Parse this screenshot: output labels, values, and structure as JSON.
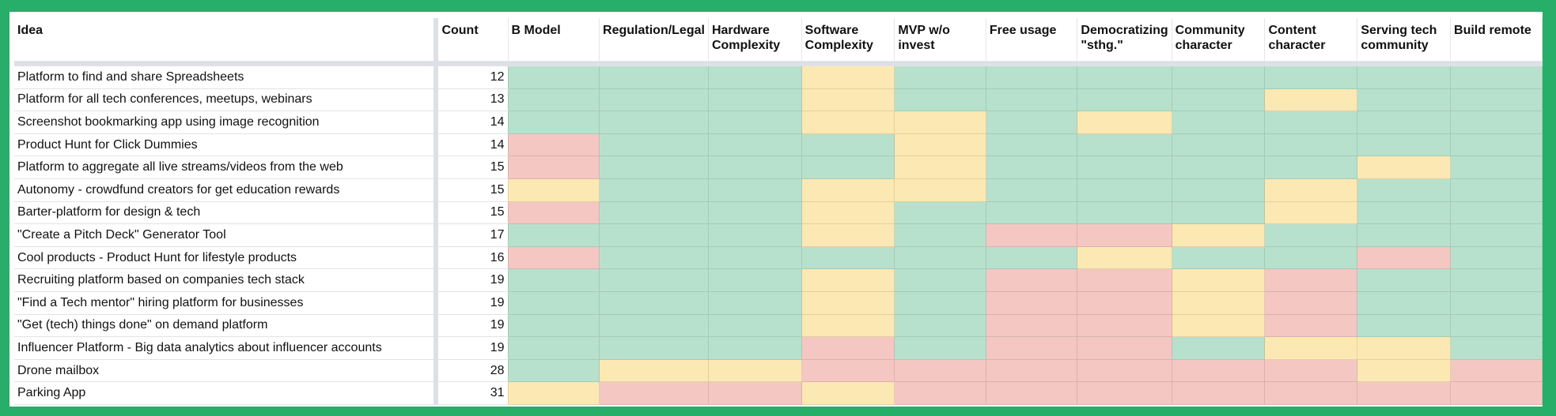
{
  "colors": {
    "border": "#27ae68",
    "G": "#b7e1cd",
    "Y": "#fce8b2",
    "R": "#f4c7c3"
  },
  "legend": {
    "G": "green",
    "Y": "yellow",
    "R": "red"
  },
  "headers": [
    "Idea",
    "Count",
    "B Model",
    "Regulation/Legal",
    "Hardware Complexity",
    "Software Complexity",
    "MVP w/o invest",
    "Free usage",
    "Democratizing \"sthg.\"",
    "Community character",
    "Content character",
    "Serving tech community",
    "Build remote"
  ],
  "rows": [
    {
      "idea": "Platform to find and share Spreadsheets",
      "count": "12",
      "ratings": [
        "G",
        "G",
        "G",
        "Y",
        "G",
        "G",
        "G",
        "G",
        "G",
        "G",
        "G"
      ]
    },
    {
      "idea": "Platform for all tech conferences, meetups, webinars",
      "count": "13",
      "ratings": [
        "G",
        "G",
        "G",
        "Y",
        "G",
        "G",
        "G",
        "G",
        "Y",
        "G",
        "G"
      ]
    },
    {
      "idea": "Screenshot bookmarking app using image recognition",
      "count": "14",
      "ratings": [
        "G",
        "G",
        "G",
        "Y",
        "Y",
        "G",
        "Y",
        "G",
        "G",
        "G",
        "G"
      ]
    },
    {
      "idea": "Product Hunt for Click Dummies",
      "count": "14",
      "ratings": [
        "R",
        "G",
        "G",
        "G",
        "Y",
        "G",
        "G",
        "G",
        "G",
        "G",
        "G"
      ]
    },
    {
      "idea": "Platform to aggregate all live streams/videos from the web",
      "count": "15",
      "ratings": [
        "R",
        "G",
        "G",
        "G",
        "Y",
        "G",
        "G",
        "G",
        "G",
        "Y",
        "G"
      ]
    },
    {
      "idea": "Autonomy - crowdfund creators for get education rewards",
      "count": "15",
      "ratings": [
        "Y",
        "G",
        "G",
        "Y",
        "Y",
        "G",
        "G",
        "G",
        "Y",
        "G",
        "G"
      ]
    },
    {
      "idea": "Barter-platform for design & tech",
      "count": "15",
      "ratings": [
        "R",
        "G",
        "G",
        "Y",
        "G",
        "G",
        "G",
        "G",
        "Y",
        "G",
        "G"
      ]
    },
    {
      "idea": "\"Create a Pitch Deck\" Generator Tool",
      "count": "17",
      "ratings": [
        "G",
        "G",
        "G",
        "Y",
        "G",
        "R",
        "R",
        "Y",
        "G",
        "G",
        "G"
      ]
    },
    {
      "idea": "Cool products - Product Hunt for lifestyle products",
      "count": "16",
      "ratings": [
        "R",
        "G",
        "G",
        "G",
        "G",
        "G",
        "Y",
        "G",
        "G",
        "R",
        "G"
      ]
    },
    {
      "idea": "Recruiting platform based on companies tech stack",
      "count": "19",
      "ratings": [
        "G",
        "G",
        "G",
        "Y",
        "G",
        "R",
        "R",
        "Y",
        "R",
        "G",
        "G"
      ]
    },
    {
      "idea": "\"Find a Tech mentor\" hiring platform for businesses",
      "count": "19",
      "ratings": [
        "G",
        "G",
        "G",
        "Y",
        "G",
        "R",
        "R",
        "Y",
        "R",
        "G",
        "G"
      ]
    },
    {
      "idea": "\"Get (tech) things done\" on demand platform",
      "count": "19",
      "ratings": [
        "G",
        "G",
        "G",
        "Y",
        "G",
        "R",
        "R",
        "Y",
        "R",
        "G",
        "G"
      ]
    },
    {
      "idea": "Influencer Platform - Big data analytics about influencer accounts",
      "count": "19",
      "ratings": [
        "G",
        "G",
        "G",
        "R",
        "G",
        "R",
        "R",
        "G",
        "Y",
        "Y",
        "G"
      ]
    },
    {
      "idea": "Drone mailbox",
      "count": "28",
      "ratings": [
        "G",
        "Y",
        "Y",
        "R",
        "R",
        "R",
        "R",
        "R",
        "R",
        "Y",
        "R"
      ]
    },
    {
      "idea": "Parking App",
      "count": "31",
      "ratings": [
        "Y",
        "R",
        "R",
        "Y",
        "R",
        "R",
        "R",
        "R",
        "R",
        "R",
        "R"
      ]
    }
  ]
}
